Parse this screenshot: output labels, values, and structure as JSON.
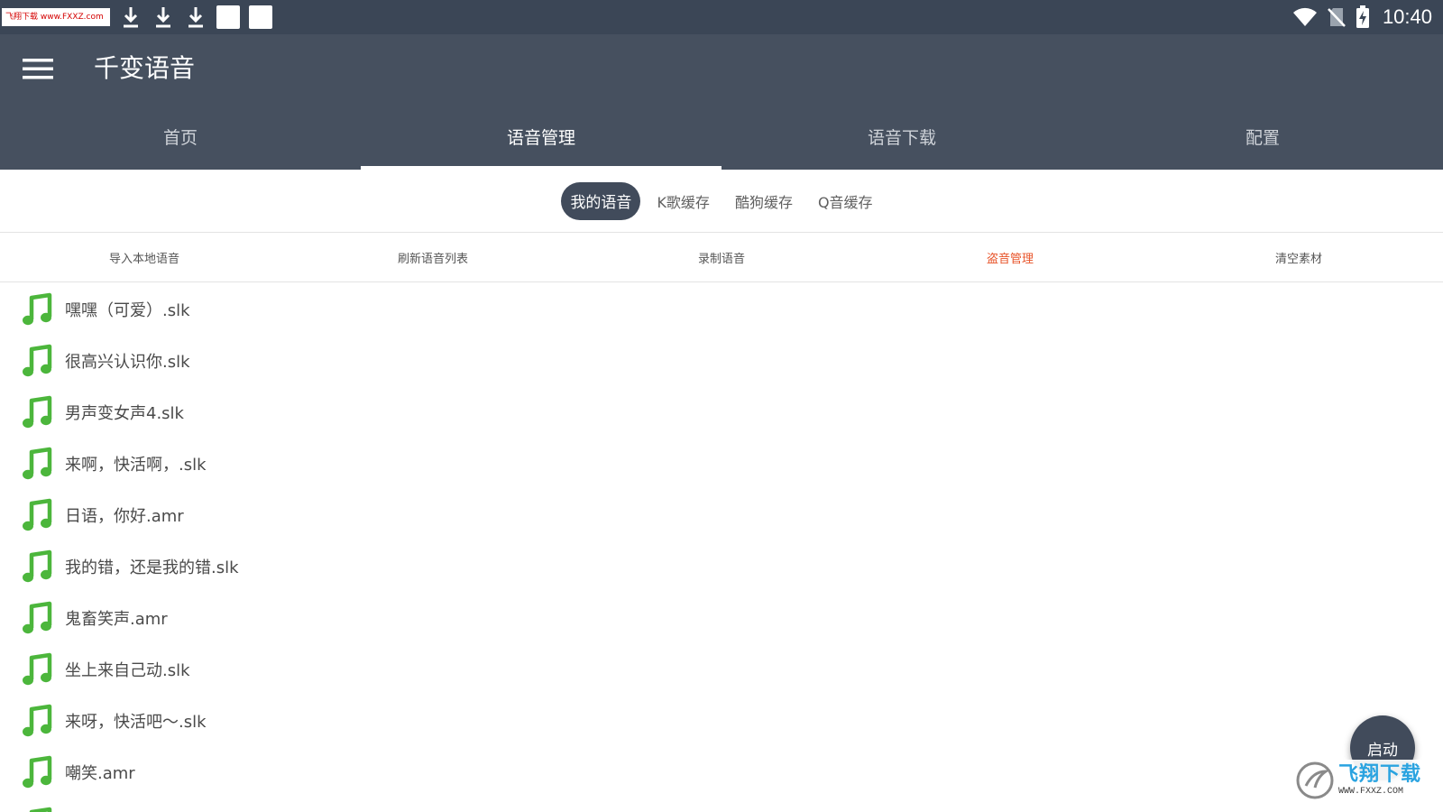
{
  "status_bar": {
    "watermark_tag": "飞翔下载 www.FXXZ.com",
    "time": "10:40",
    "icons": [
      "download-icon",
      "download-icon",
      "download-icon",
      "download-icon",
      "download-icon",
      "wifi-icon",
      "no-sim-icon",
      "battery-charging-icon"
    ]
  },
  "app_bar": {
    "title": "千变语音",
    "menu_icon": "hamburger-menu-icon"
  },
  "main_tabs": [
    {
      "label": "首页",
      "active": false
    },
    {
      "label": "语音管理",
      "active": true
    },
    {
      "label": "语音下载",
      "active": false
    },
    {
      "label": "配置",
      "active": false
    }
  ],
  "sub_tabs": [
    {
      "label": "我的语音",
      "active": true
    },
    {
      "label": "K歌缓存",
      "active": false
    },
    {
      "label": "酷狗缓存",
      "active": false
    },
    {
      "label": "Q音缓存",
      "active": false
    }
  ],
  "actions": [
    {
      "label": "导入本地语音"
    },
    {
      "label": "刷新语音列表"
    },
    {
      "label": "录制语音"
    },
    {
      "label": "盗音管理",
      "highlight": true
    },
    {
      "label": "清空素材"
    }
  ],
  "voice_list": [
    "嘿嘿（可爱）.slk",
    "很高兴认识你.slk",
    "男声变女声4.slk",
    "来啊，快活啊，.slk",
    "日语，你好.amr",
    "我的错，还是我的错.slk",
    "鬼畜笑声.amr",
    "坐上来自己动.slk",
    "来呀，快活吧～.slk",
    "嘲笑.amr"
  ],
  "fab": {
    "label": "启动"
  },
  "watermark": {
    "brand": "飞翔下载",
    "url": "WWW.FXXZ.COM"
  },
  "colors": {
    "status_bar": "#3b4656",
    "app_bar": "#46505f",
    "accent_chip": "#414b5b",
    "highlight": "#e8542a",
    "note_icon": "#4cb63c"
  }
}
